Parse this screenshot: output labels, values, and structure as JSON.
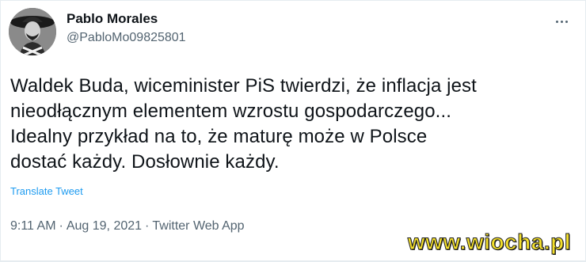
{
  "author": {
    "display_name": "Pablo Morales",
    "handle": "@PabloMo09825801",
    "avatar_icon": "user-avatar-icon"
  },
  "tweet": {
    "text": "Waldek Buda, wiceminister PiS twierdzi, że inflacja jest\nnieodłącznym elementem wzrostu gospodarczego...\nIdealny przykład na to, że maturę może w Polsce\ndostać każdy. Dosłownie każdy.",
    "translate_label": "Translate Tweet"
  },
  "meta": {
    "time": "9:11 AM",
    "separator": "·",
    "date": "Aug 19, 2021",
    "source": "Twitter Web App"
  },
  "more_icon": "more-horizontal-icon",
  "watermark": "www.wiocha.pl",
  "colors": {
    "text": "#0f1419",
    "secondary": "#536471",
    "link": "#1d9bf0",
    "border": "#e6ecf0",
    "watermark": "#f3df2a"
  }
}
